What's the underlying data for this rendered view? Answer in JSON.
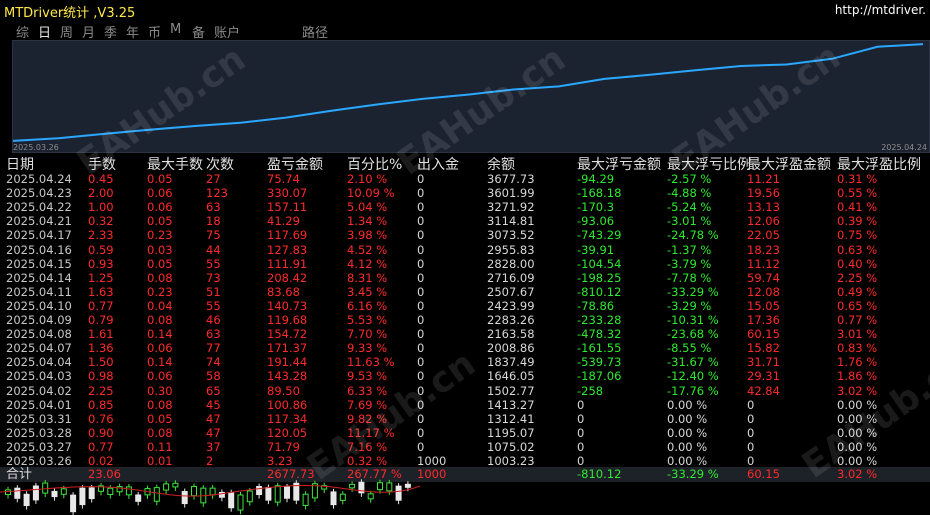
{
  "app": {
    "title": "MTDriver统计 ,V3.25",
    "url": "http://mtdriver."
  },
  "tabs": [
    {
      "label": "综"
    },
    {
      "label": "日"
    },
    {
      "label": "周"
    },
    {
      "label": "月"
    },
    {
      "label": "季"
    },
    {
      "label": "年"
    },
    {
      "label": "币"
    },
    {
      "label": "M"
    },
    {
      "label": "备"
    },
    {
      "label": "账户"
    },
    {
      "label": "路径"
    }
  ],
  "chart": {
    "start_date": "2025.03.26",
    "end_date": "2025.04.24",
    "line_color": "#2aa7ff",
    "balance_curve": [
      1003.23,
      1075.02,
      1195.07,
      1312.41,
      1413.27,
      1502.77,
      1646.05,
      1837.49,
      2008.86,
      2163.58,
      2283.26,
      2423.99,
      2507.67,
      2716.09,
      2828.0,
      2955.83,
      3073.52,
      3114.81,
      3271.92,
      3601.99,
      3677.73
    ]
  },
  "table": {
    "headers": [
      "日期",
      "手数",
      "最大手数",
      "次数",
      "盈亏金额",
      "百分比%",
      "出入金",
      "余额",
      "最大浮亏金额",
      "最大浮亏比例",
      "最大浮盈金额",
      "最大浮盈比例"
    ],
    "rows": [
      [
        "2025.04.24",
        "0.45",
        "0.05",
        "27",
        "75.74",
        "2.10 %",
        "0",
        "3677.73",
        "-94.29",
        "-2.57 %",
        "11.21",
        "0.31 %"
      ],
      [
        "2025.04.23",
        "2.00",
        "0.06",
        "123",
        "330.07",
        "10.09 %",
        "0",
        "3601.99",
        "-168.18",
        "-4.88 %",
        "19.56",
        "0.55 %"
      ],
      [
        "2025.04.22",
        "1.00",
        "0.06",
        "63",
        "157.11",
        "5.04 %",
        "0",
        "3271.92",
        "-170.3",
        "-5.24 %",
        "13.13",
        "0.41 %"
      ],
      [
        "2025.04.21",
        "0.32",
        "0.05",
        "18",
        "41.29",
        "1.34 %",
        "0",
        "3114.81",
        "-93.06",
        "-3.01 %",
        "12.06",
        "0.39 %"
      ],
      [
        "2025.04.17",
        "2.33",
        "0.23",
        "75",
        "117.69",
        "3.98 %",
        "0",
        "3073.52",
        "-743.29",
        "-24.78 %",
        "22.05",
        "0.75 %"
      ],
      [
        "2025.04.16",
        "0.59",
        "0.03",
        "44",
        "127.83",
        "4.52 %",
        "0",
        "2955.83",
        "-39.91",
        "-1.37 %",
        "18.23",
        "0.63 %"
      ],
      [
        "2025.04.15",
        "0.93",
        "0.05",
        "55",
        "111.91",
        "4.12 %",
        "0",
        "2828.00",
        "-104.54",
        "-3.79 %",
        "11.12",
        "0.40 %"
      ],
      [
        "2025.04.14",
        "1.25",
        "0.08",
        "73",
        "208.42",
        "8.31 %",
        "0",
        "2716.09",
        "-198.25",
        "-7.78 %",
        "59.74",
        "2.25 %"
      ],
      [
        "2025.04.11",
        "1.63",
        "0.23",
        "51",
        "83.68",
        "3.45 %",
        "0",
        "2507.67",
        "-810.12",
        "-33.29 %",
        "12.08",
        "0.49 %"
      ],
      [
        "2025.04.10",
        "0.77",
        "0.04",
        "55",
        "140.73",
        "6.16 %",
        "0",
        "2423.99",
        "-78.86",
        "-3.29 %",
        "15.05",
        "0.65 %"
      ],
      [
        "2025.04.09",
        "0.79",
        "0.08",
        "46",
        "119.68",
        "5.53 %",
        "0",
        "2283.26",
        "-233.28",
        "-10.31 %",
        "17.36",
        "0.77 %"
      ],
      [
        "2025.04.08",
        "1.61",
        "0.14",
        "63",
        "154.72",
        "7.70 %",
        "0",
        "2163.58",
        "-478.32",
        "-23.68 %",
        "60.15",
        "3.01 %"
      ],
      [
        "2025.04.07",
        "1.36",
        "0.06",
        "77",
        "171.37",
        "9.33 %",
        "0",
        "2008.86",
        "-161.55",
        "-8.55 %",
        "15.82",
        "0.83 %"
      ],
      [
        "2025.04.04",
        "1.50",
        "0.14",
        "74",
        "191.44",
        "11.63 %",
        "0",
        "1837.49",
        "-539.73",
        "-31.67 %",
        "31.71",
        "1.76 %"
      ],
      [
        "2025.04.03",
        "0.98",
        "0.06",
        "58",
        "143.28",
        "9.53 %",
        "0",
        "1646.05",
        "-187.06",
        "-12.40 %",
        "29.31",
        "1.86 %"
      ],
      [
        "2025.04.02",
        "2.25",
        "0.30",
        "65",
        "89.50",
        "6.33 %",
        "0",
        "1502.77",
        "-258",
        "-17.76 %",
        "42.84",
        "3.02 %"
      ],
      [
        "2025.04.01",
        "0.85",
        "0.08",
        "45",
        "100.86",
        "7.69 %",
        "0",
        "1413.27",
        "0",
        "0.00 %",
        "0",
        "0.00 %"
      ],
      [
        "2025.03.31",
        "0.76",
        "0.05",
        "47",
        "117.34",
        "9.82 %",
        "0",
        "1312.41",
        "0",
        "0.00 %",
        "0",
        "0.00 %"
      ],
      [
        "2025.03.28",
        "0.90",
        "0.08",
        "47",
        "120.05",
        "11.17 %",
        "0",
        "1195.07",
        "0",
        "0.00 %",
        "0",
        "0.00 %"
      ],
      [
        "2025.03.27",
        "0.77",
        "0.11",
        "37",
        "71.79",
        "7.16 %",
        "0",
        "1075.02",
        "0",
        "0.00 %",
        "0",
        "0.00 %"
      ],
      [
        "2025.03.26",
        "0.02",
        "0.01",
        "2",
        "3.23",
        "0.32 %",
        "1000",
        "1003.23",
        "0",
        "0.00 %",
        "0",
        "0.00 %"
      ]
    ],
    "total": [
      "合计",
      "23.06",
      "",
      "",
      "2677.73",
      "267.77 %",
      "1000",
      "",
      "-810.12",
      "-33.29 %",
      "60.15",
      "3.02 %"
    ]
  },
  "watermark": "EAHub.cn"
}
